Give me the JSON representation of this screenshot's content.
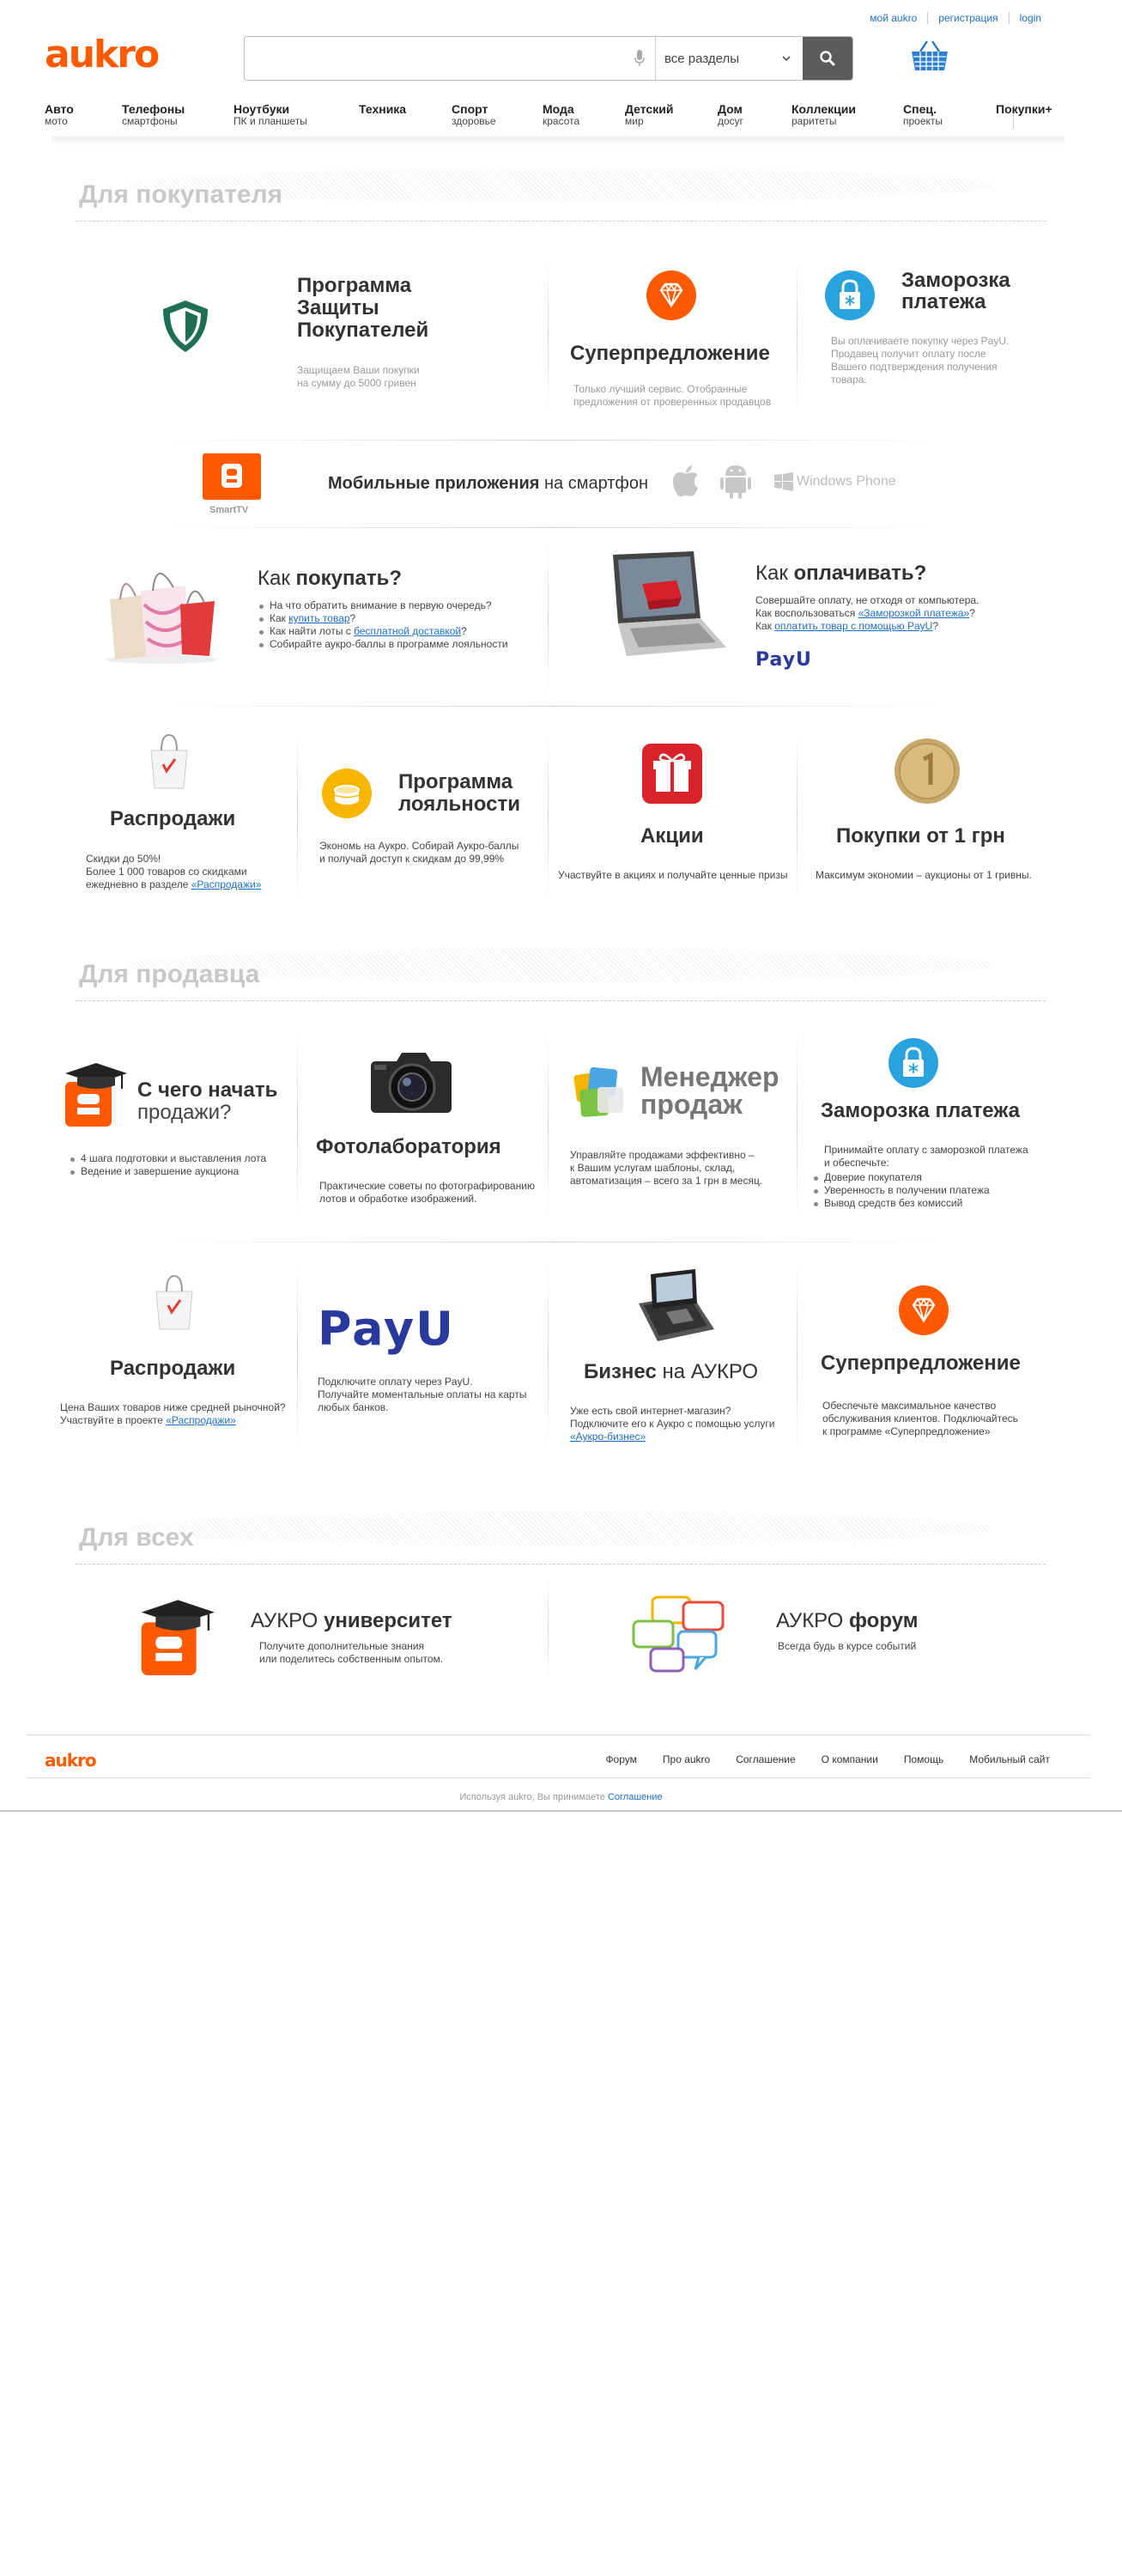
{
  "header": {
    "top_links": [
      "мой aukro",
      "регистрация",
      "login"
    ],
    "logo": "aukro",
    "search": {
      "placeholder": "",
      "section_value": "все разделы"
    },
    "nav": [
      {
        "title": "Авто",
        "sub": "мото"
      },
      {
        "title": "Телефоны",
        "sub": "смартфоны"
      },
      {
        "title": "Ноутбуки",
        "sub": "ПК и планшеты"
      },
      {
        "title": "Техника",
        "sub": ""
      },
      {
        "title": "Спорт",
        "sub": "здоровье"
      },
      {
        "title": "Мода",
        "sub": "красота"
      },
      {
        "title": "Детский",
        "sub": "мир"
      },
      {
        "title": "Дом",
        "sub": "досуг"
      },
      {
        "title": "Коллекции",
        "sub": "раритеты"
      },
      {
        "title": "Спец.",
        "sub": "проекты"
      },
      {
        "title": "Покупки+",
        "sub": ""
      }
    ]
  },
  "buyer": {
    "heading": "Для покупателя",
    "protection": {
      "title": "Программа Защиты Покупателей",
      "text": [
        "Защищаем Ваши покупки",
        "на сумму до 5000 гривен"
      ]
    },
    "super": {
      "title": "Суперпредложение",
      "text": [
        "Только лучший сервис. Отобранные",
        "предложения от проверенных продавцов"
      ]
    },
    "freeze": {
      "title": "Заморозка платежа",
      "text": [
        "Вы оплачиваете покупку через PayU.",
        "Продавец получит оплату после",
        "Вашего подтверждения получения",
        "товара."
      ]
    },
    "mobile": {
      "smarttv_label": "SmartTV",
      "title_bold": "Мобильные приложения",
      "title_rest": " на смартфон",
      "windows_phone": "Windows Phone"
    },
    "how_buy": {
      "title_light": "Как ",
      "title_bold": "покупать?",
      "items": [
        {
          "pre": "На что обратить внимание в первую очередь?",
          "link": "",
          "post": ""
        },
        {
          "pre": "Как ",
          "link": "купить товар",
          "post": "?"
        },
        {
          "pre": "Как найти лоты с ",
          "link": "бесплатной доставкой",
          "post": "?"
        },
        {
          "pre": "Собирайте аукро-баллы в программе лояльности",
          "link": "",
          "post": ""
        }
      ]
    },
    "how_pay": {
      "title_light": "Как ",
      "title_bold": "оплачивать?",
      "lines": [
        {
          "pre": "Совершайте оплату, не отходя от компьютера.",
          "link": "",
          "post": ""
        },
        {
          "pre": "Как воспользоваться ",
          "link": "«Заморозкой платежа»",
          "post": "?"
        },
        {
          "pre": "Как ",
          "link": "оплатить товар с помощью PayU",
          "post": "?"
        }
      ],
      "payu": "PayU"
    },
    "sales": {
      "title": "Распродажи",
      "lines": [
        "Скидки до 50%!",
        "Более 1 000 товаров со скидками",
        "ежедневно в разделе "
      ],
      "link": "«Распродажи»"
    },
    "loyalty": {
      "title": "Программа лояльности",
      "text": [
        "Экономь на Aукро. Собирай Аукро-баллы",
        "и получай доступ к скидкам до 99,99%"
      ]
    },
    "promo": {
      "title": "Акции",
      "text": "Участвуйте в акциях и получайте ценные призы"
    },
    "one_grn": {
      "title": "Покупки от 1 грн",
      "text": "Максимум экономии – аукционы от 1 гривны."
    }
  },
  "seller": {
    "heading": "Для продавца",
    "start": {
      "title": "С чего начать",
      "subtitle": "продажи?",
      "items": [
        "4 шага подготовки и выставления лота",
        "Ведение и завершение аукциона"
      ]
    },
    "photo": {
      "title": "Фотолаборатория",
      "text": [
        "Практические советы по фотографированию",
        "лотов и обработке изображений."
      ]
    },
    "manager": {
      "logo_line1": "Менеджер",
      "logo_line2": "продаж",
      "text": [
        "Управляйте продажами эффективно –",
        "к Вашим услугам шаблоны, склад,",
        "автоматизация – всего за 1 грн в месяц."
      ]
    },
    "freeze": {
      "title": "Заморозка платежа",
      "intro": [
        "Принимайте оплату с заморозкой платежа",
        "и обеспечьте:"
      ],
      "items": [
        "Доверие покупателя",
        "Уверенность в получении платежа",
        "Вывод средств без комиссий"
      ]
    },
    "sales": {
      "title": "Распродажи",
      "text": [
        "Цена Ваших товаров ниже средней рыночной?",
        "Участвуйте в проекте "
      ],
      "link": "«Распродажи»"
    },
    "payu": {
      "logo": "PayU",
      "text": [
        "Подключите оплату через PayU.",
        "Получайте моментальные оплаты на карты",
        "любых банков."
      ]
    },
    "business": {
      "title_bold": "Бизнес",
      "title_rest": " на АУКРО",
      "text": [
        "Уже есть свой интернет-магазин?",
        "Подключите его к Аукро с помощью услуги"
      ],
      "link": "«Аукро-бизнес»"
    },
    "super": {
      "title": "Суперпредложение",
      "text": [
        "Обеспечьте максимальное качество",
        "обслуживания клиентов. Подключайтесь",
        "к программе «Суперпредложение»"
      ]
    }
  },
  "all": {
    "heading": "Для всех",
    "university": {
      "title_light": "АУКРО ",
      "title_bold": "университет",
      "text": [
        "Получите дополнительные знания",
        "или поделитесь собственным опытом."
      ]
    },
    "forum": {
      "title_light": "АУКРО ",
      "title_bold": "форум",
      "text": "Всегда будь в курсе событий"
    }
  },
  "footer": {
    "logo": "aukro",
    "links": [
      "Форум",
      "Про aukro",
      "Соглашение",
      "О компании",
      "Помощь",
      "Мобильный сайт"
    ],
    "note_pre": "Используя aukro, Вы принимаете ",
    "note_link": "Соглашение"
  },
  "colors": {
    "brand": "#ff5a00",
    "link": "#1e6fc4",
    "icon_blue": "#29a3dd",
    "shield_green": "#1f6f57"
  }
}
